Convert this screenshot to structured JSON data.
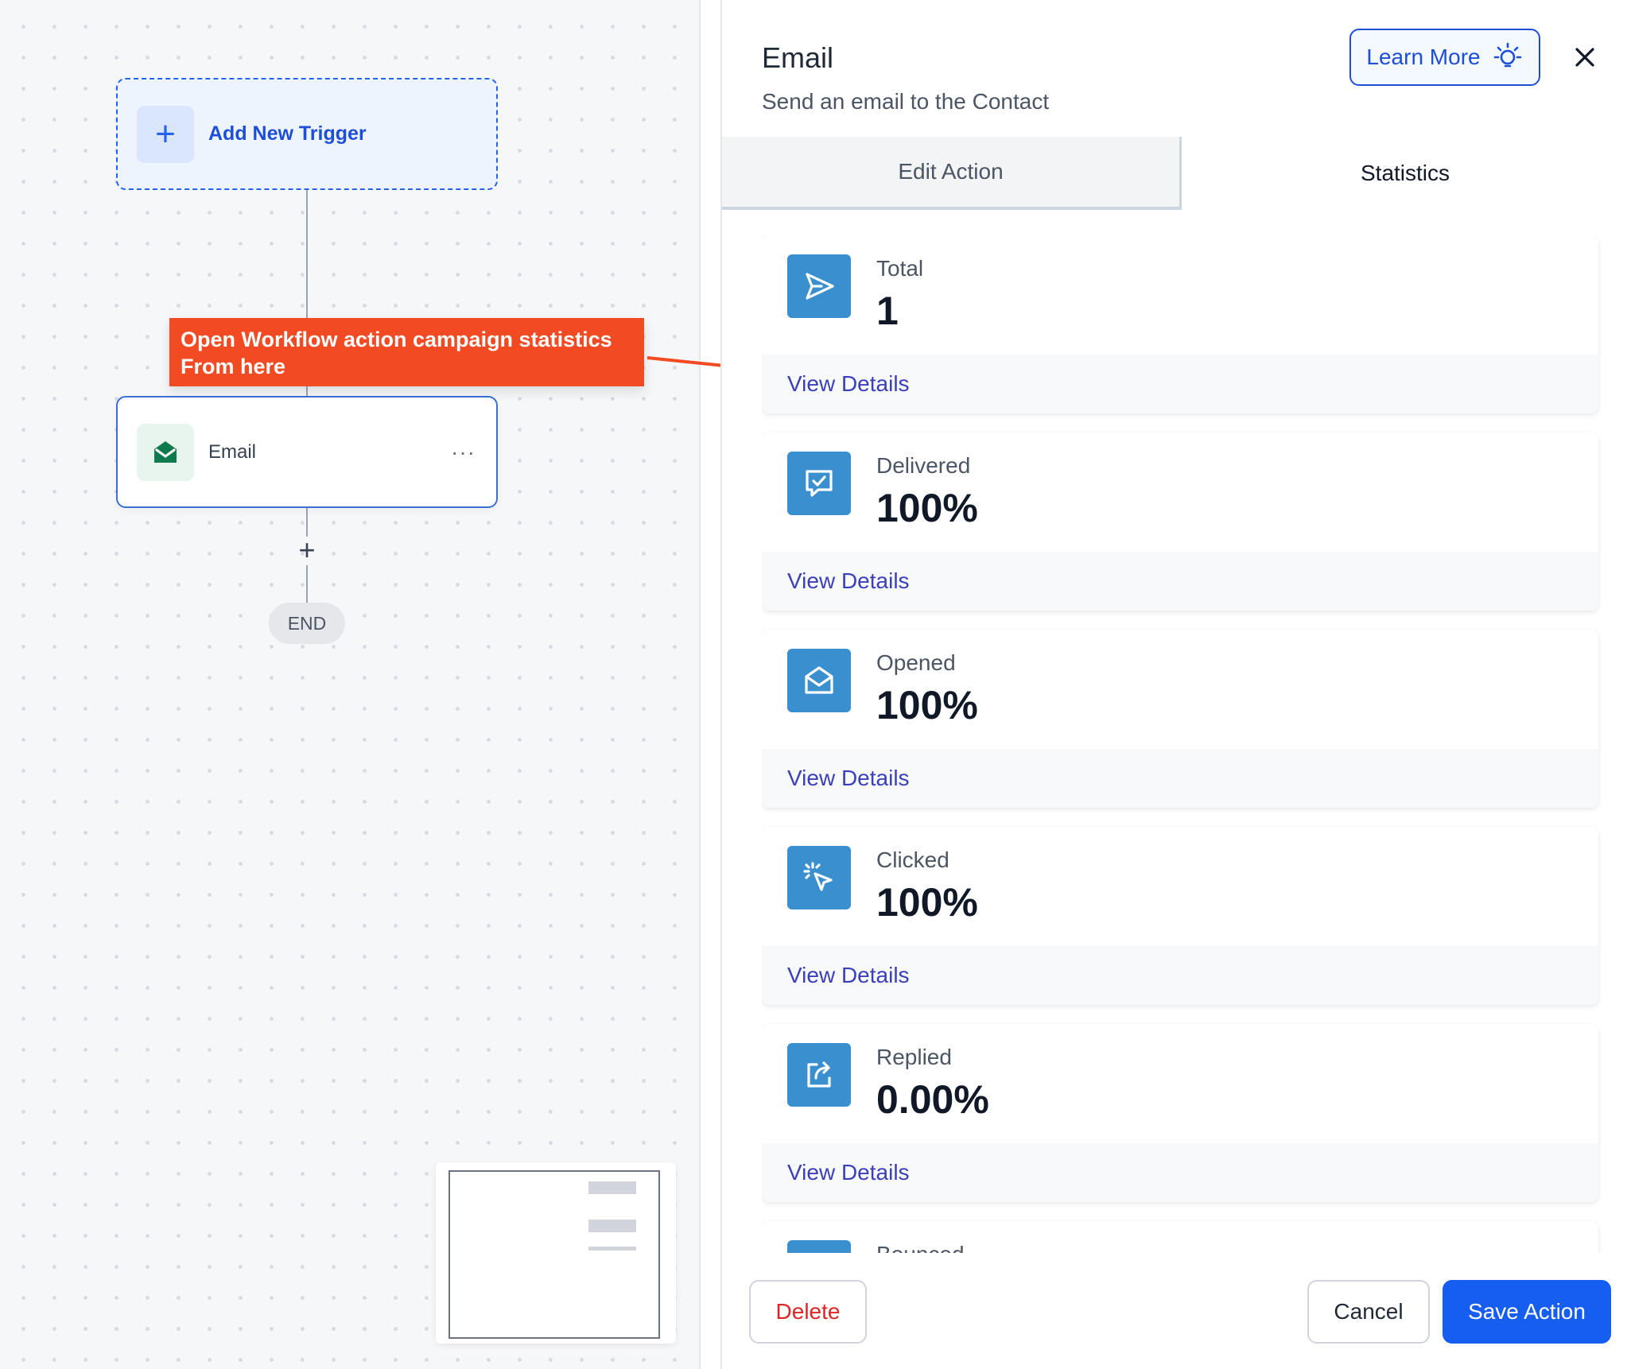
{
  "canvas": {
    "trigger": {
      "plus": "+",
      "label": "Add New Trigger"
    },
    "node": {
      "label": "Email",
      "menu": "···"
    },
    "add_step": "+",
    "end": "END",
    "callout": {
      "line1": "Open Workflow action campaign statistics",
      "line2": "From here",
      "color": "#f24a23"
    }
  },
  "panel": {
    "title": "Email",
    "subtitle": "Send an email to the Contact",
    "learn_more": "Learn More",
    "tabs": [
      {
        "label": "Edit Action",
        "active": false
      },
      {
        "label": "Statistics",
        "active": true
      }
    ],
    "stats": [
      {
        "icon": "send-icon",
        "label": "Total",
        "value": "1",
        "link": "View Details"
      },
      {
        "icon": "chat-check-icon",
        "label": "Delivered",
        "value": "100%",
        "link": "View Details"
      },
      {
        "icon": "envelope-open-icon",
        "label": "Opened",
        "value": "100%",
        "link": "View Details"
      },
      {
        "icon": "cursor-click-icon",
        "label": "Clicked",
        "value": "100%",
        "link": "View Details"
      },
      {
        "icon": "share-icon",
        "label": "Replied",
        "value": "0.00%",
        "link": "View Details"
      },
      {
        "icon": "bounce-icon",
        "label": "Bounced",
        "value": "",
        "link": ""
      }
    ],
    "buttons": {
      "delete": "Delete",
      "cancel": "Cancel",
      "save": "Save Action"
    },
    "colors": {
      "accent": "#155eef",
      "icon_bg": "#3a8fcf",
      "danger": "#dc2626",
      "link": "#3b3fb8"
    }
  }
}
